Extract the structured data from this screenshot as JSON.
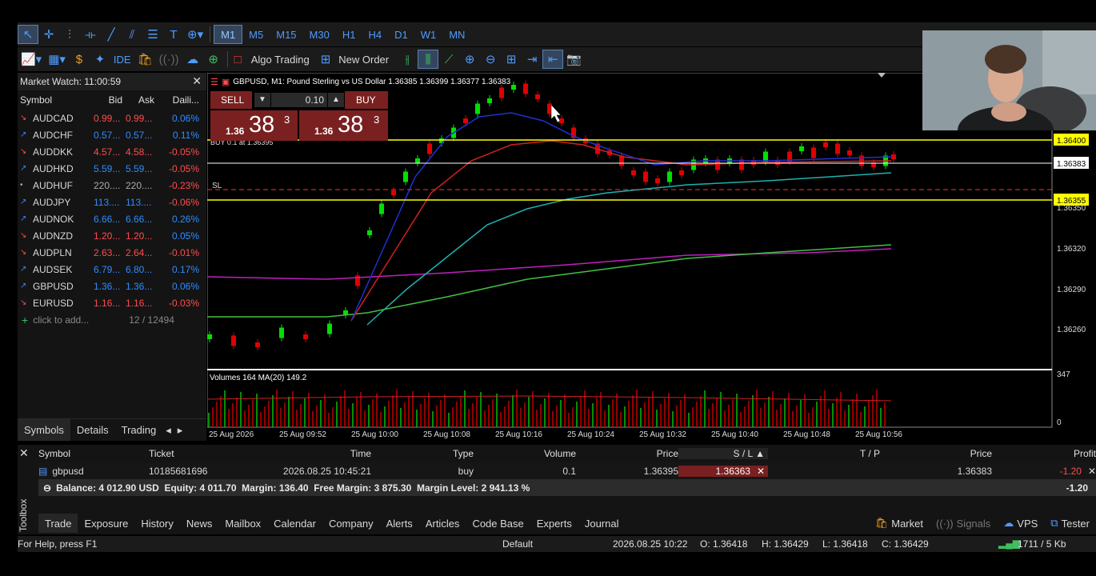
{
  "toolbar": {
    "timeframes": [
      "M1",
      "M5",
      "M15",
      "M30",
      "H1",
      "H4",
      "D1",
      "W1",
      "MN"
    ],
    "active_timeframe": "M1",
    "ide_label": "IDE",
    "algo_trading_label": "Algo Trading",
    "new_order_label": "New Order"
  },
  "market_watch": {
    "title": "Market Watch: 11:00:59",
    "headers": [
      "Symbol",
      "Bid",
      "Ask",
      "Daili..."
    ],
    "rows": [
      {
        "dir": "down",
        "symbol": "AUDCAD",
        "bid": "0.99...",
        "ask": "0.99...",
        "daily": "0.06%"
      },
      {
        "dir": "up",
        "symbol": "AUDCHF",
        "bid": "0.57...",
        "ask": "0.57...",
        "daily": "0.11%"
      },
      {
        "dir": "down",
        "symbol": "AUDDKK",
        "bid": "4.57...",
        "ask": "4.58...",
        "daily": "-0.05%"
      },
      {
        "dir": "up",
        "symbol": "AUDHKD",
        "bid": "5.59...",
        "ask": "5.59...",
        "daily": "-0.05%"
      },
      {
        "dir": "none",
        "symbol": "AUDHUF",
        "bid": "220....",
        "ask": "220....",
        "daily": "-0.23%"
      },
      {
        "dir": "up",
        "symbol": "AUDJPY",
        "bid": "113....",
        "ask": "113....",
        "daily": "-0.06%"
      },
      {
        "dir": "up",
        "symbol": "AUDNOK",
        "bid": "6.66...",
        "ask": "6.66...",
        "daily": "0.26%"
      },
      {
        "dir": "down",
        "symbol": "AUDNZD",
        "bid": "1.20...",
        "ask": "1.20...",
        "daily": "0.05%"
      },
      {
        "dir": "down",
        "symbol": "AUDPLN",
        "bid": "2.63...",
        "ask": "2.64...",
        "daily": "-0.01%"
      },
      {
        "dir": "up",
        "symbol": "AUDSEK",
        "bid": "6.79...",
        "ask": "6.80...",
        "daily": "0.17%"
      },
      {
        "dir": "up",
        "symbol": "GBPUSD",
        "bid": "1.36...",
        "ask": "1.36...",
        "daily": "0.06%"
      },
      {
        "dir": "down",
        "symbol": "EURUSD",
        "bid": "1.16...",
        "ask": "1.16...",
        "daily": "-0.03%"
      }
    ],
    "add_label": "click to add...",
    "count": "12 / 12494",
    "tabs": [
      "Symbols",
      "Details",
      "Trading"
    ]
  },
  "chart": {
    "header": "GBPUSD, M1:  Pound Sterling vs US Dollar  1.36385 1.36399 1.36377 1.36383",
    "sell_label": "SELL",
    "buy_label": "BUY",
    "lot": "0.10",
    "sell_price_prefix": "1.36",
    "sell_price_big": "38",
    "sell_price_sup": "3",
    "buy_price_prefix": "1.36",
    "buy_price_big": "38",
    "buy_price_sup": "3",
    "buy_line_label": "BUY 0.1 at 1.36395",
    "sl_label": "SL",
    "price_labels": [
      "1.36400",
      "1.36383",
      "1.36355",
      "1.36350",
      "1.36320",
      "1.36290",
      "1.36260"
    ],
    "volume_label": "Volumes 164 MA(20) 149.2",
    "volume_scale_top": "347",
    "volume_scale_bottom": "0",
    "time_labels": [
      "25 Aug 2026",
      "25 Aug 09:52",
      "25 Aug 10:00",
      "25 Aug 10:08",
      "25 Aug 10:16",
      "25 Aug 10:24",
      "25 Aug 10:32",
      "25 Aug 10:40",
      "25 Aug 10:48",
      "25 Aug 10:56"
    ]
  },
  "toolbox": {
    "headers": [
      "Symbol",
      "Ticket",
      "Time",
      "Type",
      "Volume",
      "Price",
      "S / L",
      "T / P",
      "Price",
      "Profit"
    ],
    "position": {
      "symbol": "gbpusd",
      "ticket": "10185681696",
      "time": "2026.08.25 10:45:21",
      "type": "buy",
      "volume": "0.1",
      "price": "1.36395",
      "sl": "1.36363",
      "tp": "",
      "current_price": "1.36383",
      "profit": "-1.20"
    },
    "summary": "Balance: 4 012.90 USD  Equity: 4 011.70  Margin: 136.40  Free Margin: 3 875.30  Margin Level: 2 941.13 %",
    "summary_profit": "-1.20",
    "side_label": "Toolbox",
    "tabs": [
      "Trade",
      "Exposure",
      "History",
      "News",
      "Mailbox",
      "Calendar",
      "Company",
      "Alerts",
      "Articles",
      "Code Base",
      "Experts",
      "Journal"
    ],
    "right_tabs": [
      "Market",
      "Signals",
      "VPS",
      "Tester"
    ]
  },
  "status": {
    "help": "For Help, press F1",
    "profile": "Default",
    "datetime": "2026.08.25 10:22",
    "open": "O: 1.36418",
    "high": "H: 1.36429",
    "low": "L: 1.36418",
    "close": "C: 1.36429",
    "traffic": "1711 / 5 Kb"
  },
  "colors": {
    "accent_blue": "#4f9bff",
    "bull": "#00e000",
    "bear": "#e00000",
    "level_yellow": "#ffff00"
  }
}
